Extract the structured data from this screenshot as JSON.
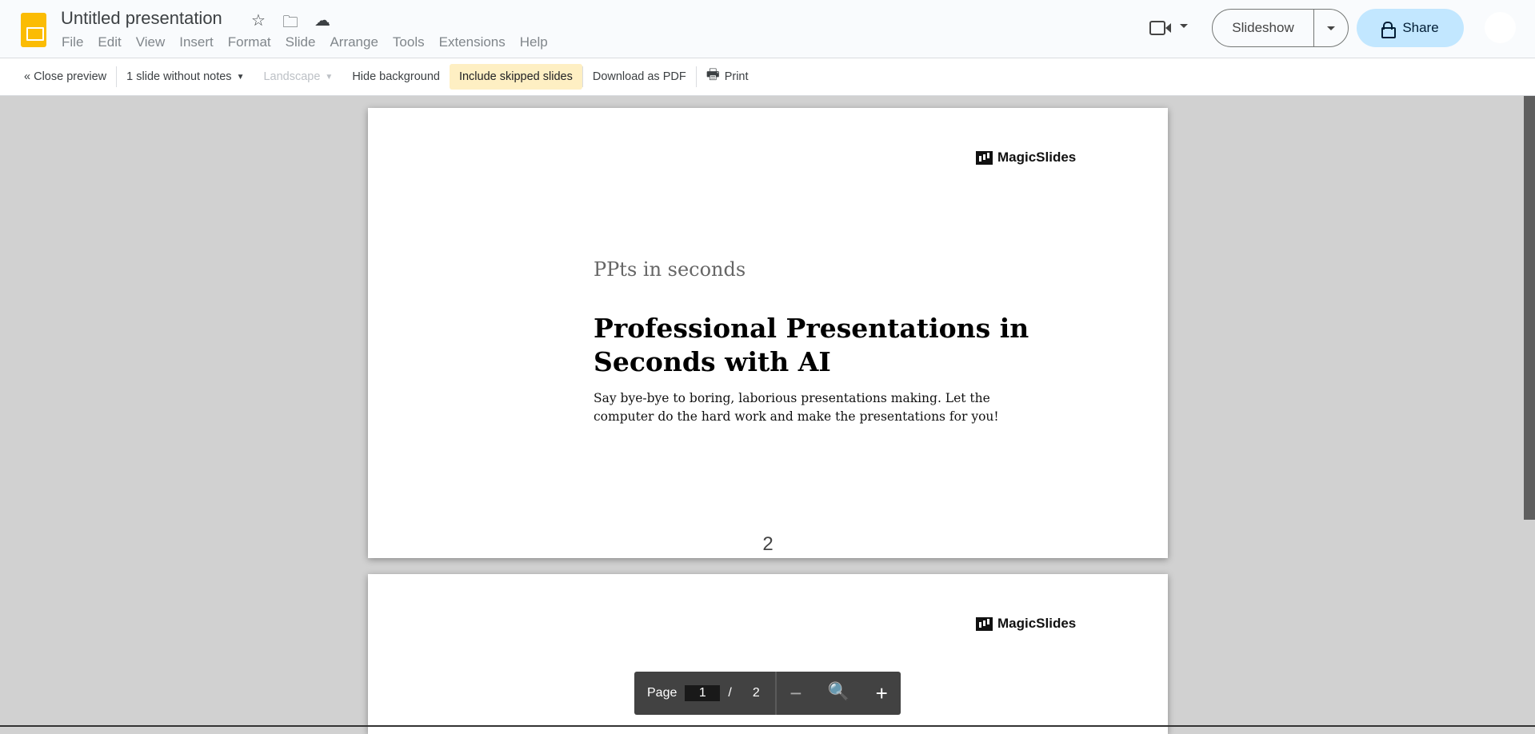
{
  "header": {
    "title": "Untitled presentation",
    "menu": [
      "File",
      "Edit",
      "View",
      "Insert",
      "Format",
      "Slide",
      "Arrange",
      "Tools",
      "Extensions",
      "Help"
    ]
  },
  "toolbar": {
    "close_preview": "« Close preview",
    "notes": "1 slide without notes",
    "orientation": "Landscape",
    "hide_background": "Hide background",
    "include_skipped": "Include skipped slides",
    "download_pdf": "Download as PDF",
    "print": "Print"
  },
  "actions": {
    "slideshow": "Slideshow",
    "share": "Share"
  },
  "slides": [
    {
      "logo": "MagicSlides",
      "subtitle": "PPts in seconds",
      "title": "Professional Presentations in Seconds with AI",
      "body": "Say bye-bye to boring, laborious presentations making. Let the computer do the hard work and make the presentations for you!",
      "page_number": "2"
    },
    {
      "logo": "MagicSlides"
    }
  ],
  "pager": {
    "label": "Page",
    "current": "1",
    "sep": "/",
    "total": "2"
  }
}
